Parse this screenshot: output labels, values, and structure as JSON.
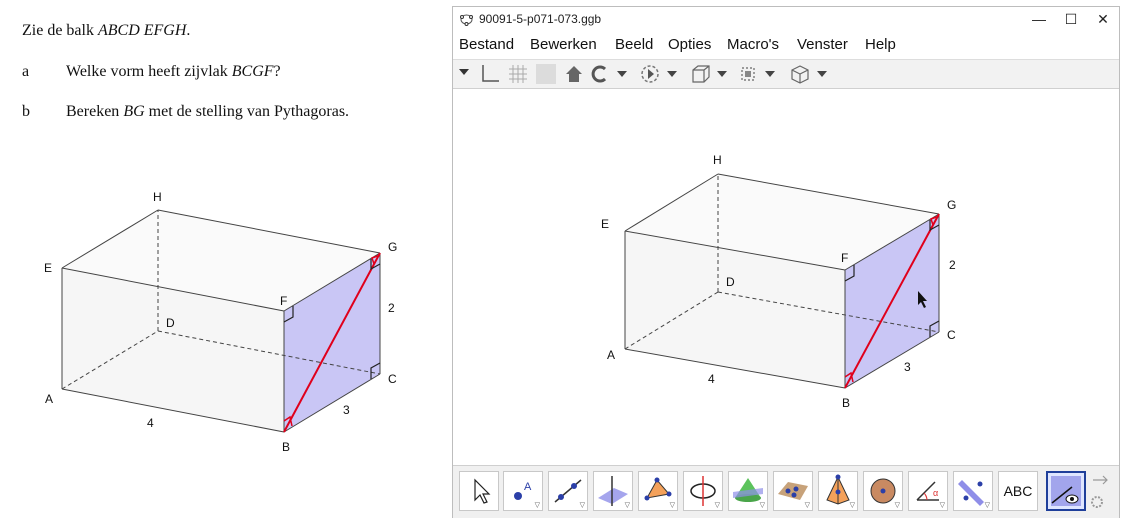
{
  "document": {
    "intro_prefix": "Zie de balk ",
    "intro_italic": "ABCD EFGH",
    "intro_suffix": ".",
    "question_a": {
      "letter": "a",
      "prefix": "Welke vorm heeft zijvlak ",
      "italic": "BCGF",
      "suffix": "?"
    },
    "question_b": {
      "letter": "b",
      "prefix": "Bereken ",
      "italic": "BG",
      "suffix": " met de stelling van Pythagoras."
    },
    "figure_labels": {
      "A": "A",
      "B": "B",
      "C": "C",
      "D": "D",
      "E": "E",
      "F": "F",
      "G": "G",
      "H": "H",
      "length_AB": "4",
      "length_BC": "3",
      "length_CG": "2"
    }
  },
  "window": {
    "title": "90091-5-p071-073.ggb",
    "controls": {
      "minimize": "—",
      "maximize": "☐",
      "close": "✕"
    },
    "menu": [
      "Bestand",
      "Bewerken",
      "Beeld",
      "Opties",
      "Macro's",
      "Venster",
      "Help"
    ],
    "graphics_labels": {
      "A": "A",
      "B": "B",
      "C": "C",
      "D": "D",
      "E": "E",
      "F": "F",
      "G": "G",
      "H": "H",
      "length_AB": "4",
      "length_BC": "3",
      "length_CG": "2"
    },
    "bottom_tools": [
      "move-tool",
      "point-tool",
      "line-tool",
      "plane-tool",
      "pyramid-tool",
      "circle-tool",
      "cone-tool",
      "net-tool",
      "prism-tool",
      "sphere-tool",
      "angle-tool",
      "reflect-tool",
      "text-tool",
      "view-tool"
    ],
    "text_tool_label": "ABC",
    "colors": {
      "face": "#c9c6f5",
      "diagonal": "#e0001b",
      "selected_tool": "#1f3f9a"
    }
  }
}
